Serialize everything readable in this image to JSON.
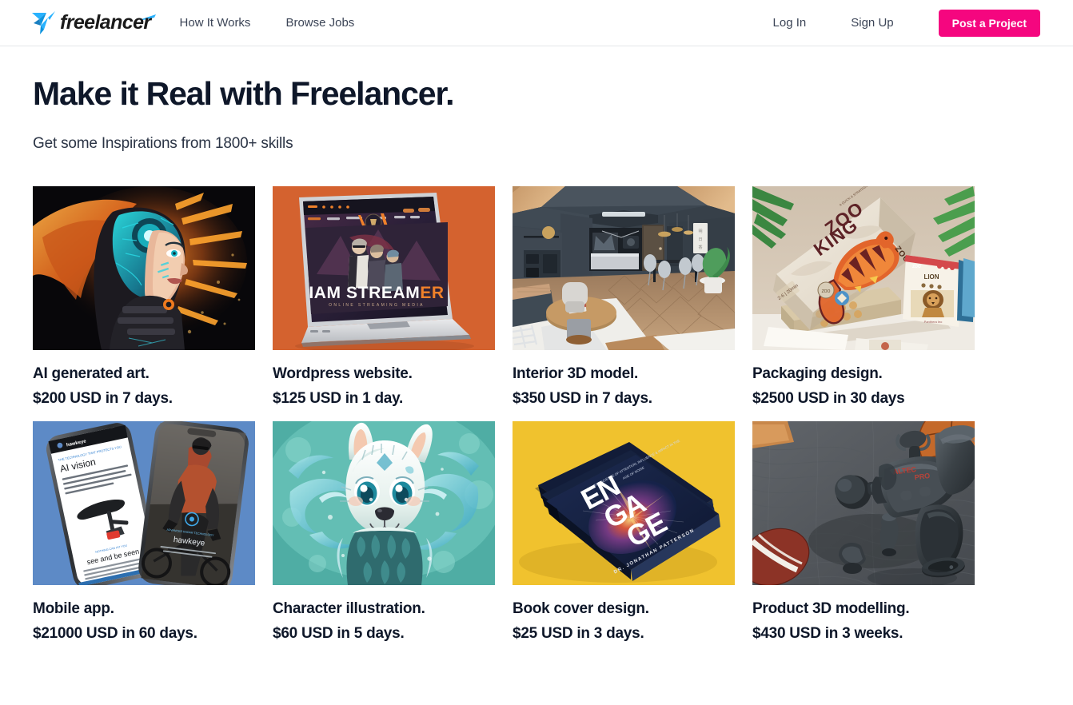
{
  "header": {
    "logo": {
      "icon": "freelancer-hummingbird-logo",
      "text": "freelancer"
    },
    "nav_left": [
      {
        "label": "How It Works",
        "name": "nav-how-it-works"
      },
      {
        "label": "Browse Jobs",
        "name": "nav-browse-jobs"
      }
    ],
    "nav_right": [
      {
        "label": "Log In",
        "name": "nav-log-in"
      },
      {
        "label": "Sign Up",
        "name": "nav-sign-up"
      }
    ],
    "post_button_label": "Post a Project",
    "accent_color": "#f5067f"
  },
  "hero": {
    "title": "Make it Real with Freelancer.",
    "subtitle": "Get some Inspirations from 1800+ skills"
  },
  "cards": [
    {
      "title": "AI generated art.",
      "price": "$200 USD in 7 days.",
      "image_name": "ai-generated-art-thumbnail",
      "image_alt": "Cyberpunk woman portrait with glowing teal cybernetic headpiece and orange paint splash on black background"
    },
    {
      "title": "Wordpress website.",
      "price": "$125 USD in 1 day.",
      "image_name": "wordpress-website-thumbnail",
      "image_alt": "Laptop mockup on orange background showing a dark gaming streamer website headlined I AM STREAMER",
      "screen_text": "IAM STREAMER",
      "screen_subtext": "ONLINE STREAMING MEDIA"
    },
    {
      "title": "Interior 3D model.",
      "price": "$350 USD in 7 days.",
      "image_name": "interior-3d-model-thumbnail",
      "image_alt": "3D render of a modern attic loft with dark grey walls, wood ceiling, herringbone floor, dining set and potted plant"
    },
    {
      "title": "Packaging design.",
      "price": "$2500 USD in 30 days",
      "image_name": "packaging-design-thumbnail",
      "image_alt": "Zoo King card game box with tiger illustration on kraft packaging beside a Lion card, palm leaves in background",
      "box_text_line1": "ZOO",
      "box_text_line2": "KING",
      "box_spine_text": "ZOO KING",
      "card_text": "LION"
    },
    {
      "title": "Mobile app.",
      "price": "$21000 USD in 60 days.",
      "image_name": "mobile-app-thumbnail",
      "image_alt": "Two smartphones on a blue background showing a cycling radar app with AI vision article and a cyclist photo",
      "screen_text_1": "AI vision",
      "screen_text_2": "see and be seen",
      "screen_text_3": "hawkeye"
    },
    {
      "title": "Character illustration.",
      "price": "$60 USD in 5 days.",
      "image_name": "character-illustration-thumbnail",
      "image_alt": "Stylised white wolf cub character with large teal eyes surrounded by swirling water on a teal background"
    },
    {
      "title": "Book cover design.",
      "price": "$25 USD in 3 days.",
      "image_name": "book-cover-design-thumbnail",
      "image_alt": "Stack of navy hardcover books titled ENGAGE on a yellow background",
      "book_title": "ENGAGE",
      "book_author": "DR. JONATHAN PATTERSON"
    },
    {
      "title": "Product 3D modelling.",
      "price": "$430 USD in 3 weeks.",
      "image_name": "product-3d-modelling-thumbnail",
      "image_alt": "3D render of a dark grey massage gun with attachment heads on a grey mat beside a basketball and a football",
      "device_brand": "ALTEC"
    }
  ]
}
